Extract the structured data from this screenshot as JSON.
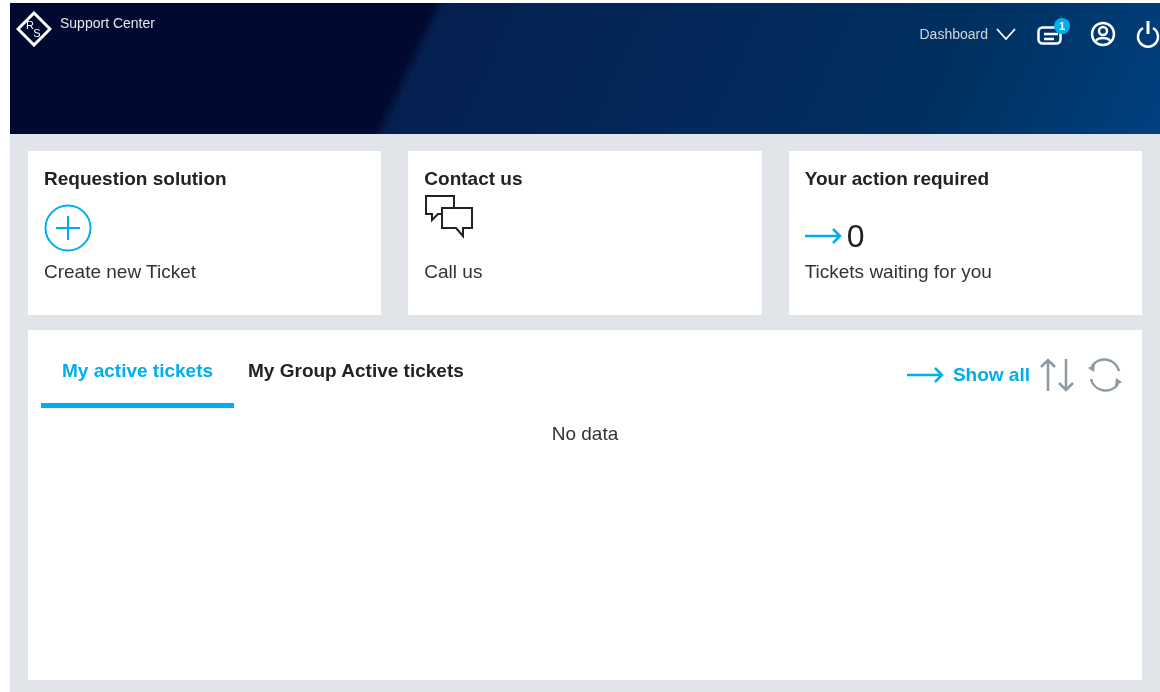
{
  "header": {
    "logo_letters": [
      "R",
      "S"
    ],
    "title": "Support Center",
    "nav": "Dashboard",
    "notification_count": "1"
  },
  "cards": [
    {
      "kind": "create",
      "title": "Requestion solution",
      "label": "Create new Ticket"
    },
    {
      "kind": "contact",
      "title": "Contact us",
      "label": "Call us"
    },
    {
      "kind": "action",
      "title": "Your action required",
      "value": "0",
      "label": "Tickets waiting for you"
    }
  ],
  "tickets": {
    "tabs": [
      {
        "label": "My active tickets",
        "selected": true
      },
      {
        "label": "My Group Active tickets",
        "selected": false
      }
    ],
    "show_all": "Show all",
    "empty": "No data"
  }
}
